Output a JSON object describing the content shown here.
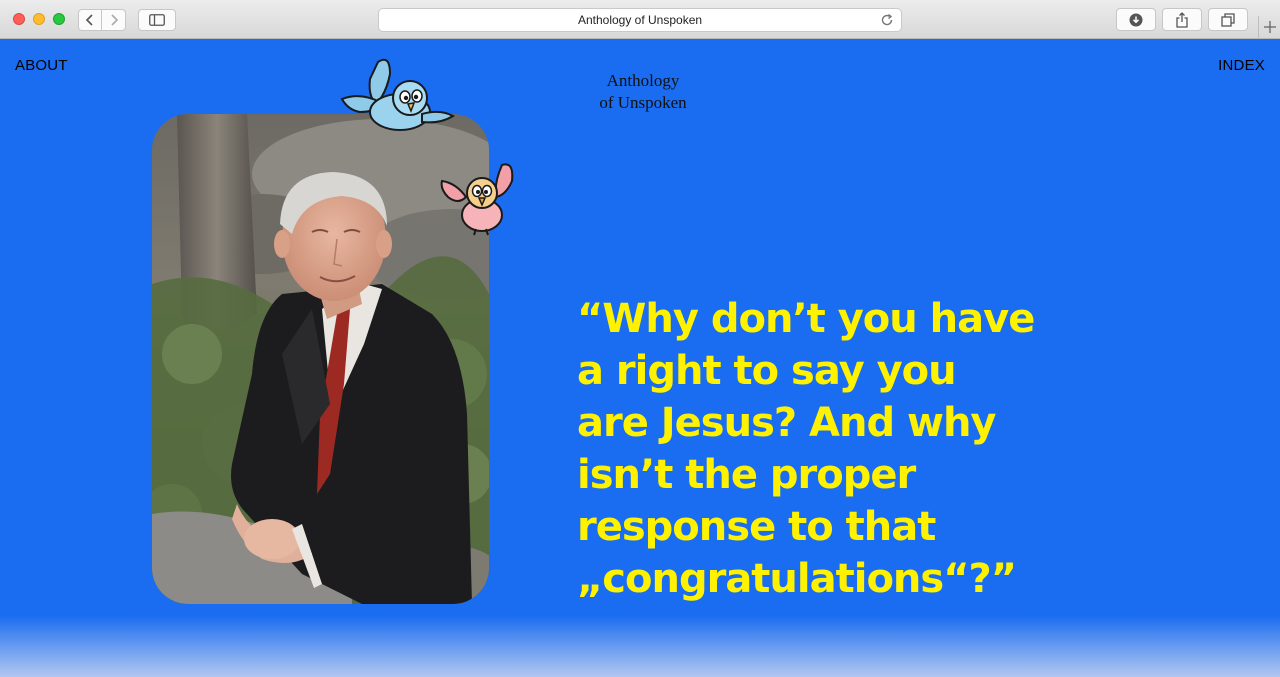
{
  "browser": {
    "url_title": "Anthology of Unspoken"
  },
  "nav": {
    "about": "ABOUT",
    "index": "INDEX"
  },
  "site": {
    "title_line1": "Anthology",
    "title_line2": "of Unspoken"
  },
  "quote": {
    "line1": "“Why don’t you have",
    "line2": "a right to say you",
    "line3": "are Jesus? And why",
    "line4": "isn’t the proper",
    "line5": "response to that",
    "line6": "„congratulations“?”"
  },
  "colors": {
    "background": "#1a6cf0",
    "quote_text": "#fff200",
    "nav_text": "#000000"
  },
  "icons": {
    "back": "chevron-left-icon",
    "forward": "chevron-right-icon",
    "sidebar": "sidebar-icon",
    "reload": "reload-icon",
    "download": "download-icon",
    "share": "share-icon",
    "tabs": "tabs-icon",
    "new_tab": "plus-icon"
  }
}
